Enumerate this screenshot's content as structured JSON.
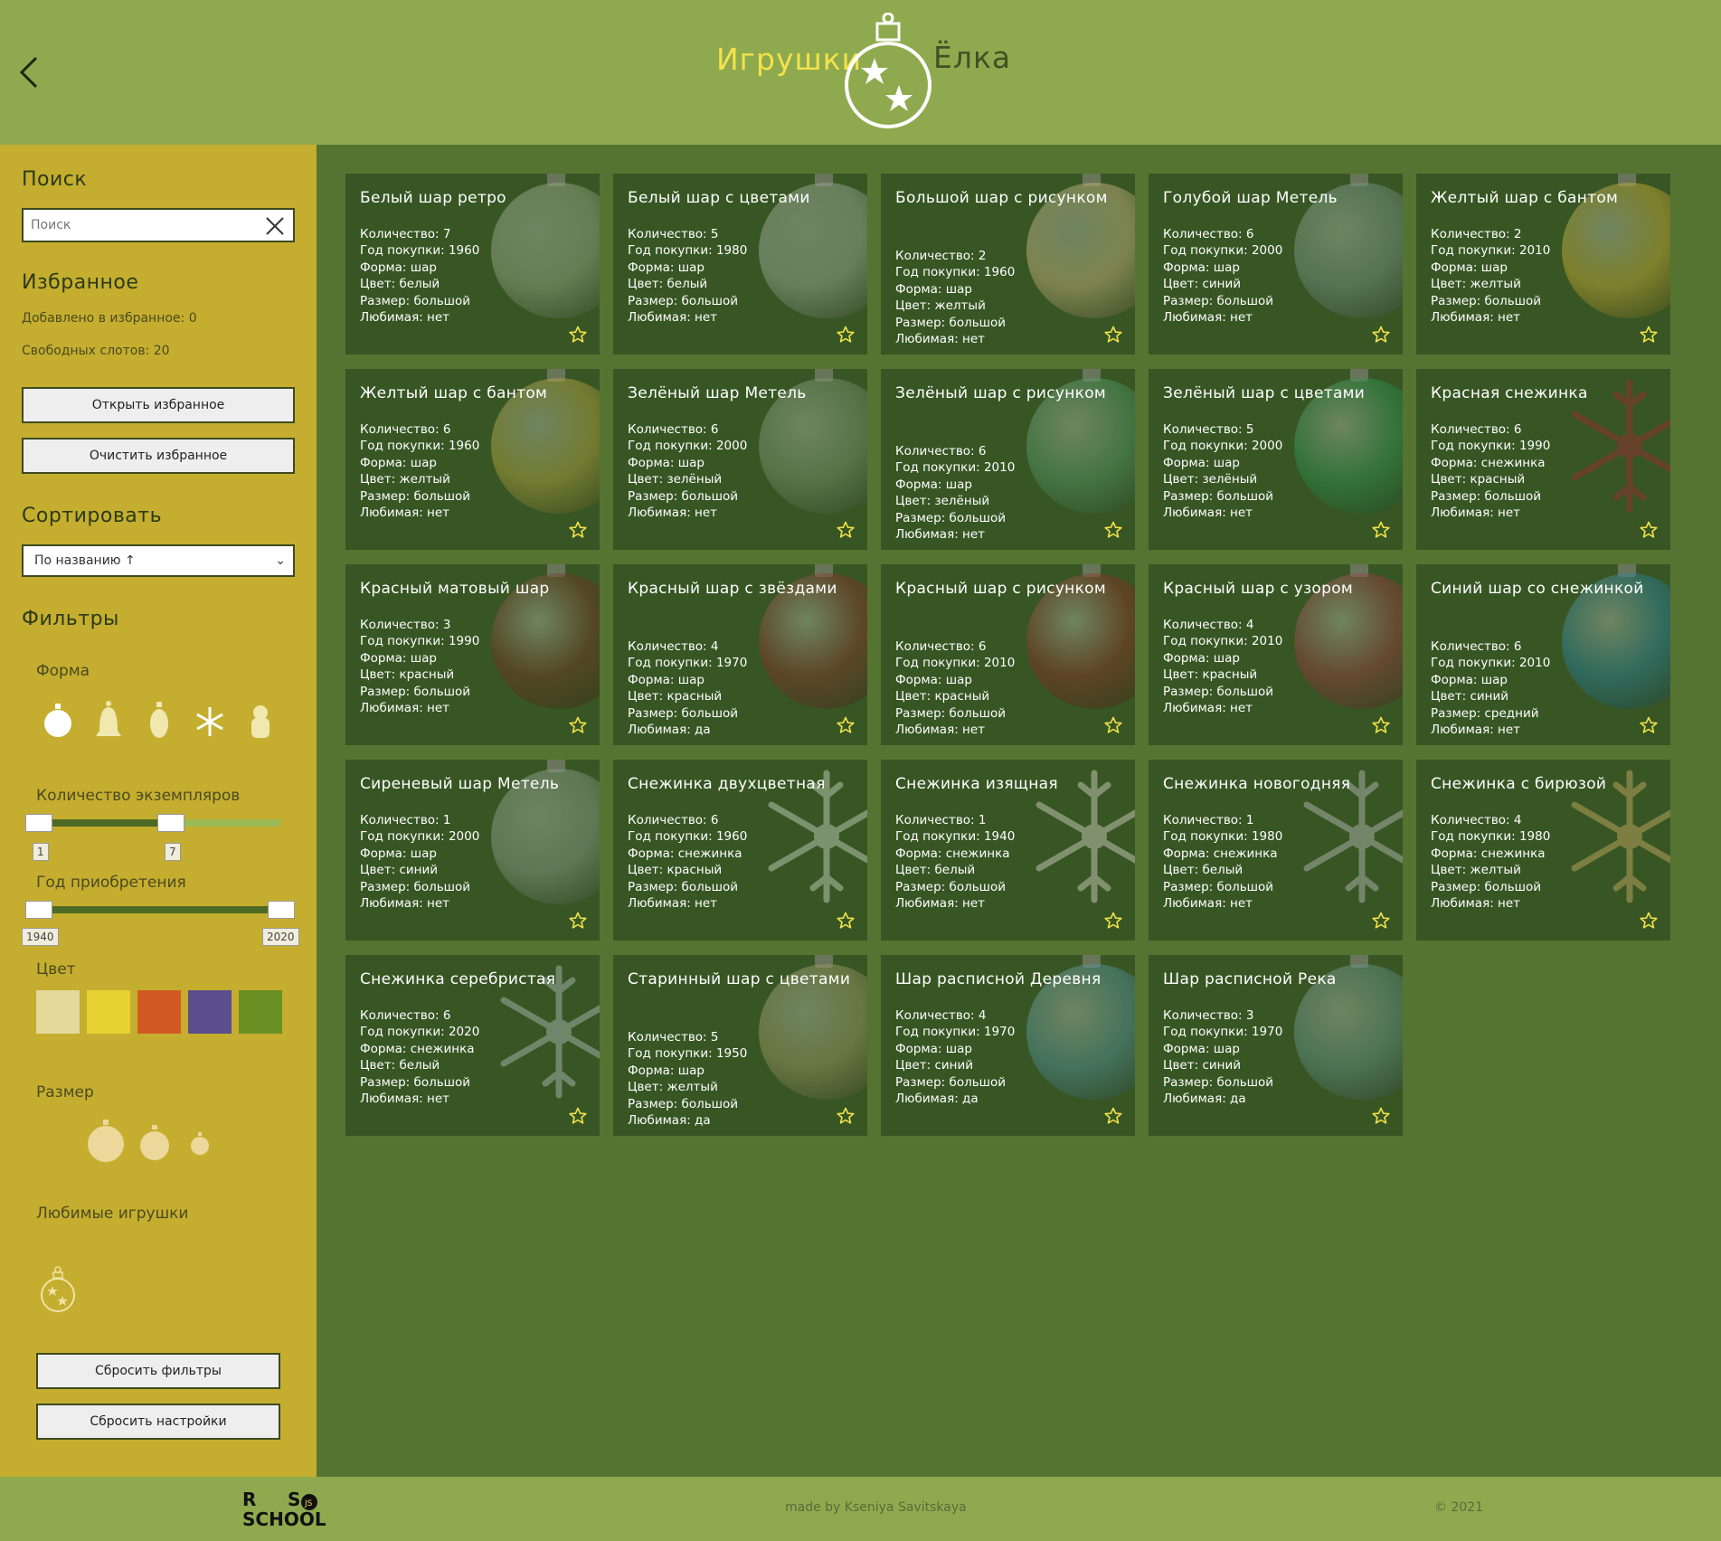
{
  "header": {
    "title_left": "Игрушки",
    "title_right": "Ёлка",
    "back_icon": "chevron-left-icon"
  },
  "sidebar": {
    "search_title": "Поиск",
    "search_placeholder": "Поиск",
    "favorites_title": "Избранное",
    "favorites_added": "Добавлено в избранное: 0",
    "favorites_free": "Свободных слотов: 20",
    "open_favorites": "Открыть избранное",
    "clear_favorites": "Очистить избранное",
    "sort_title": "Сортировать",
    "sort_value": "По названию ↑",
    "filters_title": "Фильтры",
    "shape_title": "Форма",
    "quantity_title": "Количество экземпляров",
    "quantity_min": "1",
    "quantity_max": "7",
    "year_title": "Год приобретения",
    "year_min": "1940",
    "year_max": "2020",
    "color_title": "Цвет",
    "colors": [
      "#e3d99a",
      "#e6d230",
      "#d25a22",
      "#5b4e8c",
      "#6a8f22"
    ],
    "size_title": "Размер",
    "favorite_title": "Любимые игрушки",
    "reset_filters": "Сбросить фильтры",
    "reset_settings": "Сбросить настройки"
  },
  "labels": {
    "count": "Количество: ",
    "year": "Год покупки: ",
    "shape": "Форма: ",
    "color": "Цвет: ",
    "size": "Размер: ",
    "fav": "Любимая: "
  },
  "cards": [
    {
      "title": "Белый шар ретро",
      "count": "7",
      "year": "1960",
      "shape": "шар",
      "color": "белый",
      "size": "большой",
      "fav": "нет",
      "tone": "#8c9d7a"
    },
    {
      "title": "Белый шар с цветами",
      "count": "5",
      "year": "1980",
      "shape": "шар",
      "color": "белый",
      "size": "большой",
      "fav": "нет",
      "tone": "#8fa088"
    },
    {
      "title": "Большой шар с рисунком",
      "count": "2",
      "year": "1960",
      "shape": "шар",
      "color": "желтый",
      "size": "большой",
      "fav": "нет",
      "tone": "#b6a873"
    },
    {
      "title": "Голубой шар Метель",
      "count": "6",
      "year": "2000",
      "shape": "шар",
      "color": "синий",
      "size": "большой",
      "fav": "нет",
      "tone": "#6c8c78"
    },
    {
      "title": "Желтый шар с бантом",
      "count": "2",
      "year": "2010",
      "shape": "шар",
      "color": "желтый",
      "size": "большой",
      "fav": "нет",
      "tone": "#b7a232"
    },
    {
      "title": "Желтый шар с бантом",
      "count": "6",
      "year": "1960",
      "shape": "шар",
      "color": "желтый",
      "size": "большой",
      "fav": "нет",
      "tone": "#a49a3c"
    },
    {
      "title": "Зелёный шар Метель",
      "count": "6",
      "year": "2000",
      "shape": "шар",
      "color": "зелёный",
      "size": "большой",
      "fav": "нет",
      "tone": "#6f8a62"
    },
    {
      "title": "Зелёный шар с рисунком",
      "count": "6",
      "year": "2010",
      "shape": "шар",
      "color": "зелёный",
      "size": "большой",
      "fav": "нет",
      "tone": "#4f8e5c"
    },
    {
      "title": "Зелёный шар с цветами",
      "count": "5",
      "year": "2000",
      "shape": "шар",
      "color": "зелёный",
      "size": "большой",
      "fav": "нет",
      "tone": "#2f8a4a"
    },
    {
      "title": "Красная снежинка",
      "count": "6",
      "year": "1990",
      "shape": "снежинка",
      "color": "красный",
      "size": "большой",
      "fav": "нет",
      "tone": "#7a3a2e"
    },
    {
      "title": "Красный матовый шар",
      "count": "3",
      "year": "1990",
      "shape": "шар",
      "color": "красный",
      "size": "большой",
      "fav": "нет",
      "tone": "#6b3a22"
    },
    {
      "title": "Красный шар с звёздами",
      "count": "4",
      "year": "1970",
      "shape": "шар",
      "color": "красный",
      "size": "большой",
      "fav": "да",
      "tone": "#7a3a2a"
    },
    {
      "title": "Красный шар с рисунком",
      "count": "6",
      "year": "2010",
      "shape": "шар",
      "color": "красный",
      "size": "большой",
      "fav": "нет",
      "tone": "#7d3524"
    },
    {
      "title": "Красный шар с узором",
      "count": "4",
      "year": "2010",
      "shape": "шар",
      "color": "красный",
      "size": "большой",
      "fav": "нет",
      "tone": "#8a3f3a"
    },
    {
      "title": "Синий шар со снежинкой",
      "count": "6",
      "year": "2010",
      "shape": "шар",
      "color": "синий",
      "size": "средний",
      "fav": "нет",
      "tone": "#2b7a8a"
    },
    {
      "title": "Сиреневый шар Метель",
      "count": "1",
      "year": "2000",
      "shape": "шар",
      "color": "синий",
      "size": "большой",
      "fav": "нет",
      "tone": "#7f927a"
    },
    {
      "title": "Снежинка двухцветная",
      "count": "6",
      "year": "1960",
      "shape": "снежинка",
      "color": "красный",
      "size": "большой",
      "fav": "нет",
      "tone": "#9aaa8c"
    },
    {
      "title": "Снежинка изящная",
      "count": "1",
      "year": "1940",
      "shape": "снежинка",
      "color": "белый",
      "size": "большой",
      "fav": "нет",
      "tone": "#a0aa90"
    },
    {
      "title": "Снежинка новогодняя",
      "count": "1",
      "year": "1980",
      "shape": "снежинка",
      "color": "белый",
      "size": "большой",
      "fav": "нет",
      "tone": "#8f9a88"
    },
    {
      "title": "Снежинка с бирюзой",
      "count": "4",
      "year": "1980",
      "shape": "снежинка",
      "color": "желтый",
      "size": "большой",
      "fav": "нет",
      "tone": "#9a9050"
    },
    {
      "title": "Снежинка серебристая",
      "count": "6",
      "year": "2020",
      "shape": "снежинка",
      "color": "белый",
      "size": "большой",
      "fav": "нет",
      "tone": "#8a9a88"
    },
    {
      "title": "Старинный шар с цветами",
      "count": "5",
      "year": "1950",
      "shape": "шар",
      "color": "желтый",
      "size": "большой",
      "fav": "да",
      "tone": "#8e8f5a"
    },
    {
      "title": "Шар расписной Деревня",
      "count": "4",
      "year": "1970",
      "shape": "шар",
      "color": "синий",
      "size": "большой",
      "fav": "да",
      "tone": "#4f8a8a"
    },
    {
      "title": "Шар расписной Река",
      "count": "3",
      "year": "1970",
      "shape": "шар",
      "color": "синий",
      "size": "большой",
      "fav": "да",
      "tone": "#5d8a7a"
    }
  ],
  "footer": {
    "rs_logo_text": "RS SCHOOL",
    "made_by": "made by Kseniya Savitskaya",
    "copyright": "© 2021"
  }
}
